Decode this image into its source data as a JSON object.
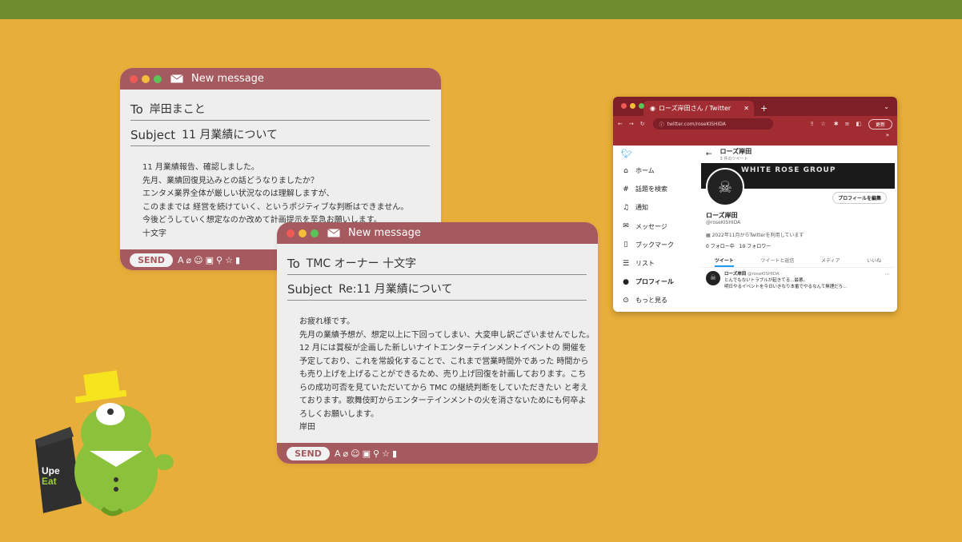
{
  "mail1": {
    "title": "New message",
    "to_label": "To",
    "to_value": "岸田まこと",
    "subject_label": "Subject",
    "subject_value": "11 月業績について",
    "body": [
      "11 月業績報告、確認しました。",
      "先月、業績回復見込みとの話どうなりましたか？",
      "エンタメ業界全体が厳しい状況なのは理解しますが、",
      "このままでは 経営を続けていく、というポジティブな判断はできません。",
      "今後どうしていく想定なのか改めて計画提示を至急お願いします。",
      "十文字"
    ],
    "send": "SEND"
  },
  "mail2": {
    "title": "New message",
    "to_label": "To",
    "to_value": "TMC オーナー 十文字",
    "subject_label": "Subject",
    "subject_value": "Re:11 月業績について",
    "body": [
      "お疲れ様です。",
      "先月の業績予想が、想定以上に下回ってしまい、大変申し訳ございませんでした。",
      "12 月には賞桜が企画した新しいナイトエンターテインメントイベントの 開催を",
      "予定しており、これを常設化することで、これまで営業時間外であった 時間から",
      "も売り上げを上げることができるため、売り上げ回復を計画しております。こち",
      "らの成功可否を見ていただいてから TMC の継続判断をしていただきたい と考え",
      "ております。歌舞伎町からエンターテインメントの火を消さないためにも何卒よ",
      "ろしくお願いします。",
      "岸田"
    ],
    "send": "SEND"
  },
  "browser": {
    "tab_title": "ローズ岸田さん / Twitter",
    "url": "twitter.com/roseKISHIDA",
    "update_label": "更新",
    "nav": [
      "ホーム",
      "話題を検索",
      "通知",
      "メッセージ",
      "ブックマーク",
      "リスト",
      "プロフィール",
      "もっと見る"
    ],
    "profile_name": "ローズ岸田",
    "tweet_count": "3 件のツイート",
    "handle": "@roseKISHIDA",
    "edit_profile": "プロフィールを編集",
    "joined": "2022年11月からTwitterを利用しています",
    "following": "0 フォロー中",
    "followers": "10 フォロワー",
    "tabs": [
      "ツイート",
      "ツイートと返信",
      "メディア",
      "いいね"
    ],
    "tweet_author": "ローズ岸田",
    "tweet_handle": "@roseKISHIDA ·",
    "tweet_line1": "とんでもないトラブルが起きてる...最悪。",
    "tweet_line2": "明日やるイベントを今日いきなり本番でやるなんて無理だろ...",
    "banner_text": "WHITE ROSE GROUP"
  },
  "mascot": {
    "bag_text": "Uber Eats"
  }
}
